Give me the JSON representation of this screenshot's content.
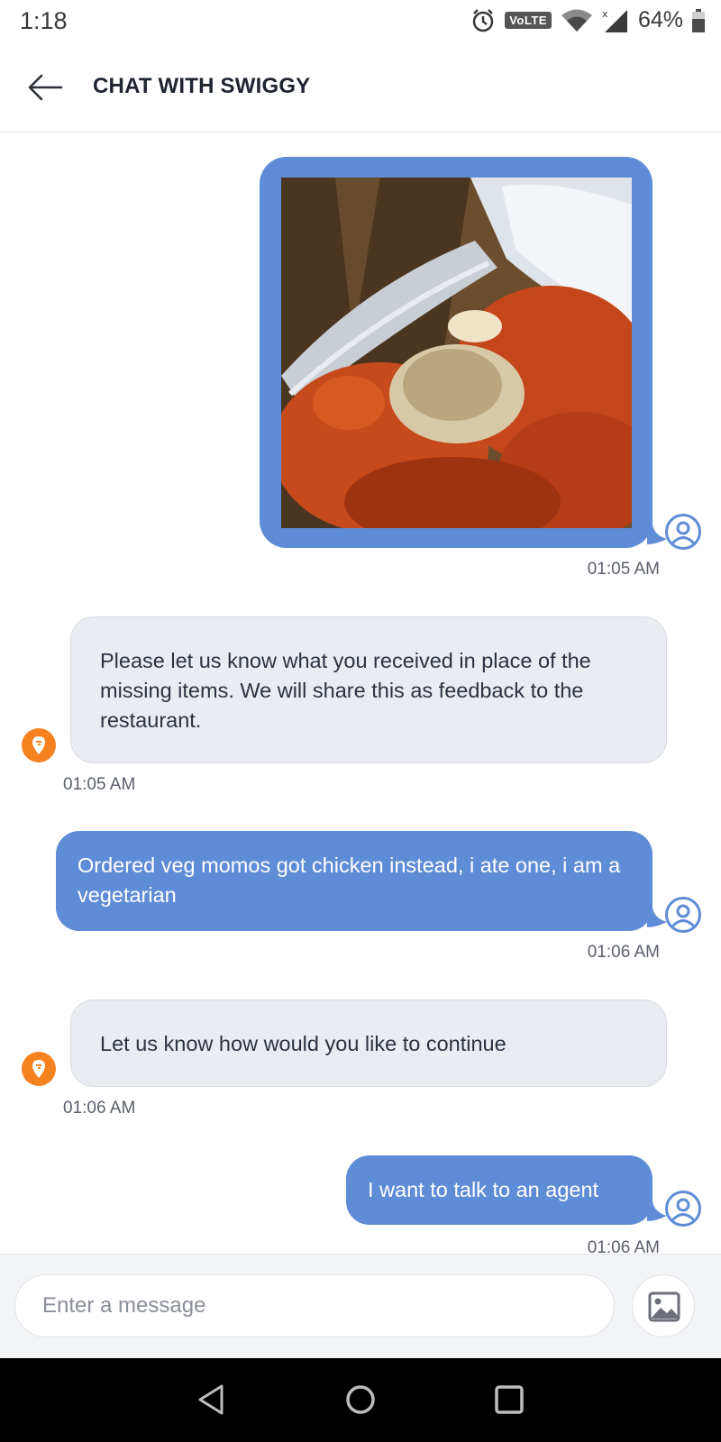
{
  "status_bar": {
    "time": "1:18",
    "network_badge": "VoLTE",
    "battery": "64%"
  },
  "header": {
    "title": "CHAT WITH SWIGGY",
    "back_icon": "arrow-left-icon"
  },
  "colors": {
    "user_bubble": "#5f8cd6",
    "bot_bubble": "#e9ecf0",
    "brand_orange": "#f6821f",
    "header_text": "#1f2431"
  },
  "messages": [
    {
      "sender": "user",
      "type": "image",
      "image": "photo of fried momos in foil tray",
      "time": "01:05 AM"
    },
    {
      "sender": "bot",
      "type": "text",
      "text": "Please let us know what you received in place of the missing items. We will share this as feedback to the restaurant.",
      "time": "01:05 AM"
    },
    {
      "sender": "user",
      "type": "text",
      "text": "Ordered veg momos got chicken instead, i ate one, i am a vegetarian",
      "time": "01:06 AM"
    },
    {
      "sender": "bot",
      "type": "text",
      "text": "Let us know how would you like to continue",
      "time": "01:06 AM"
    },
    {
      "sender": "user",
      "type": "text",
      "text": "I want to talk to an agent",
      "time": "01:06 AM"
    }
  ],
  "composer": {
    "placeholder": "Enter a message",
    "attach_icon": "image-icon"
  },
  "navbar": {
    "buttons": [
      "back-triangle-icon",
      "home-circle-icon",
      "recents-square-icon"
    ]
  }
}
